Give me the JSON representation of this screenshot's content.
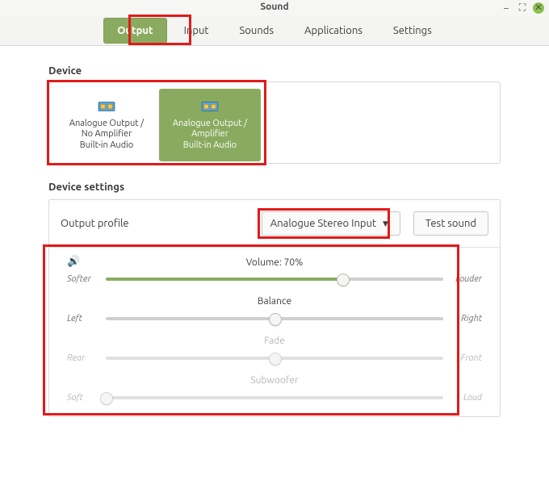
{
  "window": {
    "title": "Sound"
  },
  "tabs": [
    {
      "label": "Output",
      "active": true
    },
    {
      "label": "Input",
      "active": false
    },
    {
      "label": "Sounds",
      "active": false
    },
    {
      "label": "Applications",
      "active": false
    },
    {
      "label": "Settings",
      "active": false
    }
  ],
  "sections": {
    "device_title": "Device",
    "device_settings_title": "Device settings"
  },
  "devices": [
    {
      "line1": "Analogue Output /",
      "line2": "No Amplifier",
      "line3": "Built-in Audio",
      "active": false
    },
    {
      "line1": "Analogue Output /",
      "line2": "Amplifier",
      "line3": "Built-in Audio",
      "active": true
    }
  ],
  "settings": {
    "profile_label": "Output profile",
    "profile_value": "Analogue Stereo Input",
    "test_button": "Test sound"
  },
  "sliders": {
    "volume": {
      "label": "Volume: 70%",
      "percent": 70,
      "label_left": "Softer",
      "label_right": "Louder",
      "enabled": true
    },
    "balance": {
      "label": "Balance",
      "percent": 50,
      "label_left": "Left",
      "label_right": "Right",
      "enabled": true
    },
    "fade": {
      "label": "Fade",
      "percent": 50,
      "label_left": "Rear",
      "label_right": "Front",
      "enabled": false
    },
    "subwoofer": {
      "label": "Subwoofer",
      "percent": 0,
      "label_left": "Soft",
      "label_right": "Loud",
      "enabled": false
    }
  }
}
